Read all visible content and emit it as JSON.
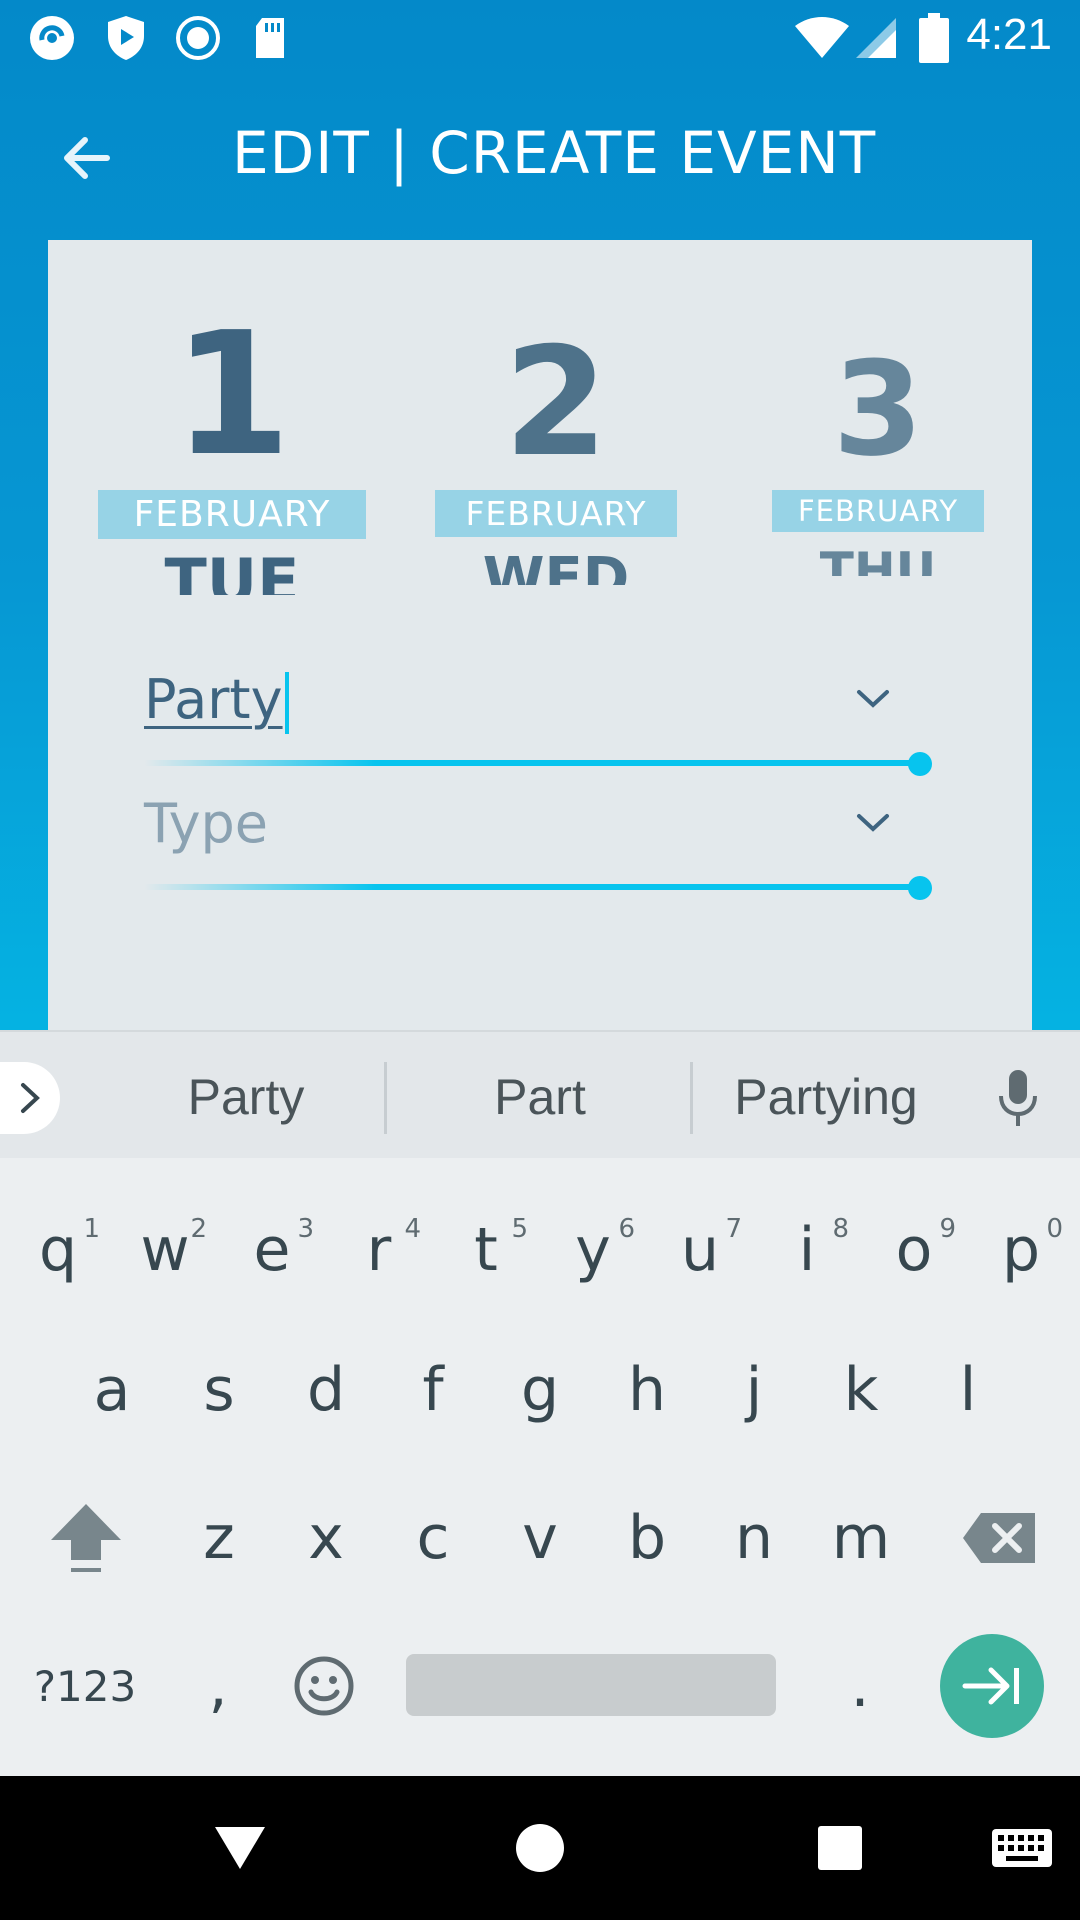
{
  "status_bar": {
    "time": "4:21",
    "left_icons": [
      "app-logo-icon",
      "shield-play-icon",
      "record-icon",
      "sd-card-icon"
    ],
    "right_icons": [
      "wifi-icon",
      "signal-icon",
      "battery-icon"
    ]
  },
  "app_bar": {
    "title": "EDIT | CREATE EVENT",
    "back_icon": "arrow-back-icon"
  },
  "date_picker": [
    {
      "day_number": "1",
      "month": "FEBRUARY",
      "weekday": "TUE",
      "selected": true
    },
    {
      "day_number": "2",
      "month": "FEBRUARY",
      "weekday": "WED",
      "selected": false
    },
    {
      "day_number": "3",
      "month": "FEBRUARY",
      "weekday": "THU",
      "selected": false
    }
  ],
  "form": {
    "name_field": {
      "value": "Party",
      "dropdown_icon": "chevron-down-icon"
    },
    "type_field": {
      "placeholder": "Type",
      "value": "",
      "dropdown_icon": "chevron-down-icon"
    }
  },
  "suggestions": [
    "Party",
    "Part",
    "Partying"
  ],
  "keyboard": {
    "row1": [
      {
        "k": "q",
        "h": "1"
      },
      {
        "k": "w",
        "h": "2"
      },
      {
        "k": "e",
        "h": "3"
      },
      {
        "k": "r",
        "h": "4"
      },
      {
        "k": "t",
        "h": "5"
      },
      {
        "k": "y",
        "h": "6"
      },
      {
        "k": "u",
        "h": "7"
      },
      {
        "k": "i",
        "h": "8"
      },
      {
        "k": "o",
        "h": "9"
      },
      {
        "k": "p",
        "h": "0"
      }
    ],
    "row2": [
      "a",
      "s",
      "d",
      "f",
      "g",
      "h",
      "j",
      "k",
      "l"
    ],
    "row3": [
      "z",
      "x",
      "c",
      "v",
      "b",
      "n",
      "m"
    ],
    "symbols_label": "?123",
    "comma": ",",
    "period": "."
  },
  "colors": {
    "header_top": "#0489c9",
    "accent": "#07c4ee",
    "card_bg": "#e3e9ec",
    "date_text": "#3e6480",
    "enter_key": "#3fb39e"
  }
}
